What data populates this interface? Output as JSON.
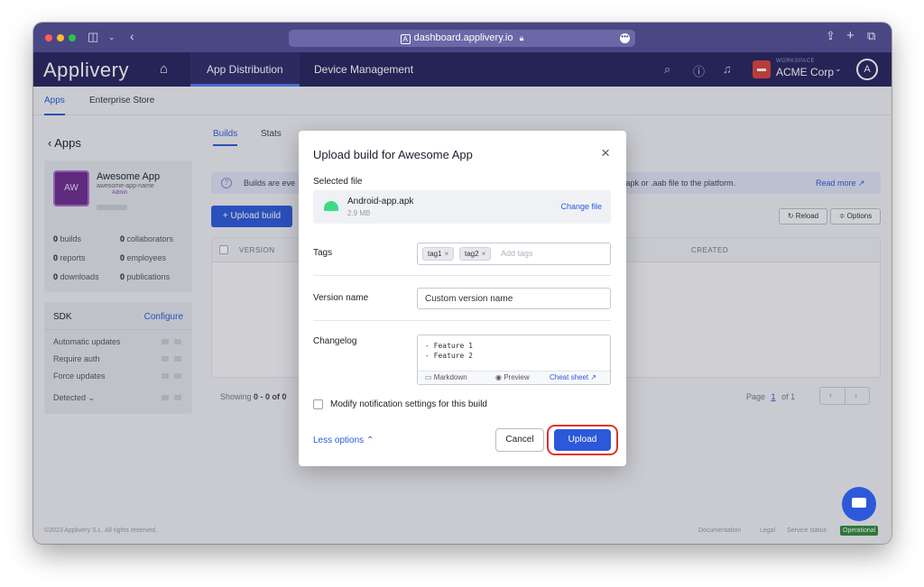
{
  "browser": {
    "url": "dashboard.applivery.io",
    "colors": {
      "titlebar": "#4a4784"
    }
  },
  "navbar": {
    "logo": "Applivery",
    "tabs": [
      {
        "label": "App Distribution"
      },
      {
        "label": "Device Management"
      }
    ],
    "workspace_label": "WORKSPACE",
    "workspace_name": "ACME Corp",
    "avatar_letter": "A"
  },
  "subnav": {
    "tabs": [
      {
        "label": "Apps"
      },
      {
        "label": "Enterprise Store"
      }
    ]
  },
  "sidebar": {
    "back_label": "Apps",
    "app": {
      "initials": "AW",
      "name": "Awesome App",
      "slug": "awesome-app-name",
      "role": "Admin"
    },
    "stats": [
      {
        "value": "0",
        "label": "builds"
      },
      {
        "value": "0",
        "label": "collaborators"
      },
      {
        "value": "0",
        "label": "reports"
      },
      {
        "value": "0",
        "label": "employees"
      },
      {
        "value": "0",
        "label": "downloads"
      },
      {
        "value": "0",
        "label": "publications"
      }
    ],
    "sdk": {
      "title": "SDK",
      "configure": "Configure",
      "rows": [
        "Automatic updates",
        "Require auth",
        "Force updates",
        "Detected"
      ]
    }
  },
  "main": {
    "tabs": [
      {
        "label": "Builds"
      },
      {
        "label": "Stats"
      }
    ],
    "info_start": "Builds are eve",
    "info_end": ".apk or .aab file to the platform.",
    "read_more": "Read more",
    "upload_button": "+ Upload build",
    "reload": "Reload",
    "options": "Options",
    "col_version": "VERSION",
    "col_created": "CREATED",
    "showing_prefix": "Showing ",
    "showing_range": "0 - 0 of 0",
    "page_label": "Page",
    "page_current": "1",
    "page_of": "of 1"
  },
  "footer": {
    "copyright": "©2023 Applivery S.L. All rights reserved.",
    "documentation": "Documentation",
    "legal": "Legal",
    "service_status": "Service status",
    "operational": "Operational"
  },
  "modal": {
    "title": "Upload build for Awesome App",
    "selected_file_label": "Selected file",
    "file_name": "Android-app.apk",
    "file_size": "2.9 MB",
    "change_file": "Change file",
    "tags_label": "Tags",
    "tags": [
      "tag1",
      "tag2"
    ],
    "tags_placeholder": "Add tags",
    "version_name_label": "Version name",
    "version_name_value": "Custom version name",
    "changelog_label": "Changelog",
    "changelog_value": "- Feature 1\n- Feature 2",
    "markdown": "Markdown",
    "preview": "Preview",
    "cheat_sheet": "Cheat sheet",
    "notify_label": "Modify notification settings for this build",
    "less_options": "Less options",
    "cancel": "Cancel",
    "upload": "Upload"
  }
}
